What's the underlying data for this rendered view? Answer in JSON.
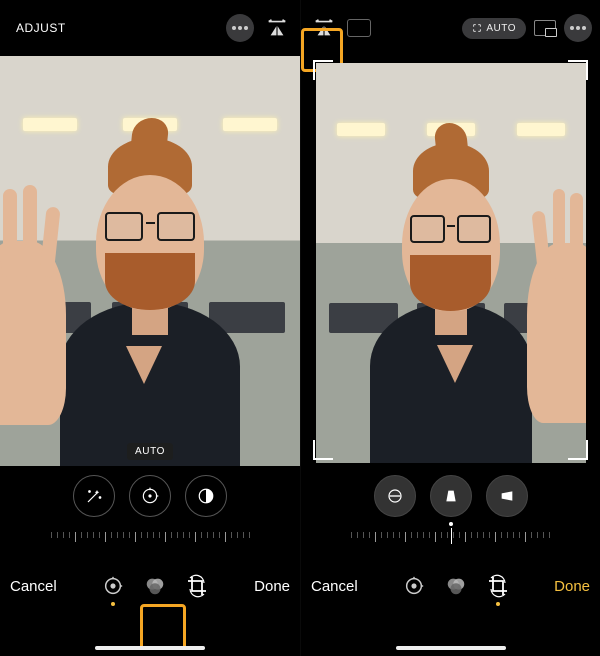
{
  "left": {
    "topTabs": {
      "adjust": "ADJUST",
      "more": "more-icon",
      "modeIcon": "flip-horizontal-icon"
    },
    "autoBadge": "AUTO",
    "tools": {
      "wand": "magic-wand-icon",
      "exposure": "exposure-dial-icon",
      "contrast": "contrast-icon"
    },
    "bottom": {
      "cancel": "Cancel",
      "done": "Done",
      "modes": {
        "tune": "tune-icon",
        "filters": "filters-icon",
        "crop": "crop-rotate-icon"
      }
    }
  },
  "right": {
    "top": {
      "auto": "AUTO",
      "aspect": "aspect-ratio-icon",
      "more": "more-icon"
    },
    "tools": {
      "straighten": "straighten-icon",
      "vertical": "perspective-vertical-icon",
      "horizontal": "perspective-horizontal-icon"
    },
    "bottom": {
      "cancel": "Cancel",
      "done": "Done",
      "modes": {
        "tune": "tune-icon",
        "filters": "filters-icon",
        "crop": "crop-rotate-icon"
      }
    }
  }
}
